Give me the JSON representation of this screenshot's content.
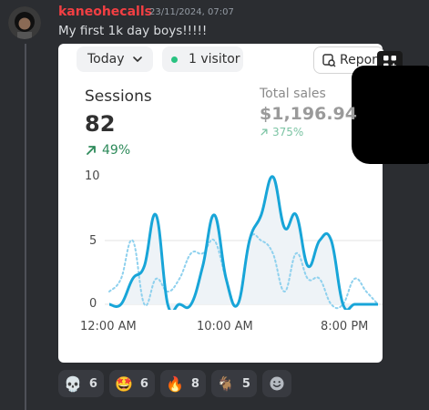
{
  "message": {
    "username": "kaneohecalls",
    "timestamp": "23/11/2024, 07:07",
    "text": "My first 1k day boys!!!!!"
  },
  "card": {
    "date_filter": "Today",
    "visitors": "1 visitor",
    "report_button": "Report",
    "sessions_label": "Sessions",
    "sessions_value": "82",
    "sessions_change": "49%",
    "sales_label": "Total sales",
    "sales_value": "$1,196.94",
    "sales_change": "375%",
    "colors": {
      "accent": "#18a5d8",
      "positive": "#2d8a5a",
      "muted_positive": "#7cc4a4"
    }
  },
  "chart_data": {
    "type": "line",
    "x_tick_labels": [
      "12:00 AM",
      "10:00 AM",
      "8:00 PM"
    ],
    "y_tick_labels": [
      "10",
      "5",
      "0"
    ],
    "ylim": [
      0,
      10
    ],
    "grid": true,
    "x_hours": [
      0,
      1,
      2,
      3,
      4,
      5,
      6,
      7,
      8,
      9,
      10,
      11,
      12,
      13,
      14,
      15,
      16,
      17,
      18,
      19,
      20,
      21,
      22,
      23
    ],
    "series": [
      {
        "style": "solid",
        "color": "#18a5d8",
        "values": [
          0,
          0,
          2,
          3,
          7,
          0,
          0,
          0,
          3,
          7,
          2,
          0,
          5,
          7,
          10,
          6,
          7,
          3,
          5,
          5,
          0,
          0,
          0,
          0
        ]
      },
      {
        "style": "dotted",
        "color": "#8fd1ee",
        "values": [
          1,
          2,
          5,
          0,
          2,
          1,
          2,
          4,
          4,
          5,
          2,
          0,
          5,
          5,
          4,
          1,
          4,
          2,
          2,
          0,
          0,
          2,
          1,
          0
        ]
      }
    ]
  },
  "reactions": [
    {
      "emoji": "💀",
      "count": "6"
    },
    {
      "emoji": "🤩",
      "count": "6"
    },
    {
      "emoji": "🔥",
      "count": "8"
    },
    {
      "emoji": "🐐",
      "count": "5"
    }
  ],
  "add_reaction_icon": "smiley-add-reaction-icon"
}
